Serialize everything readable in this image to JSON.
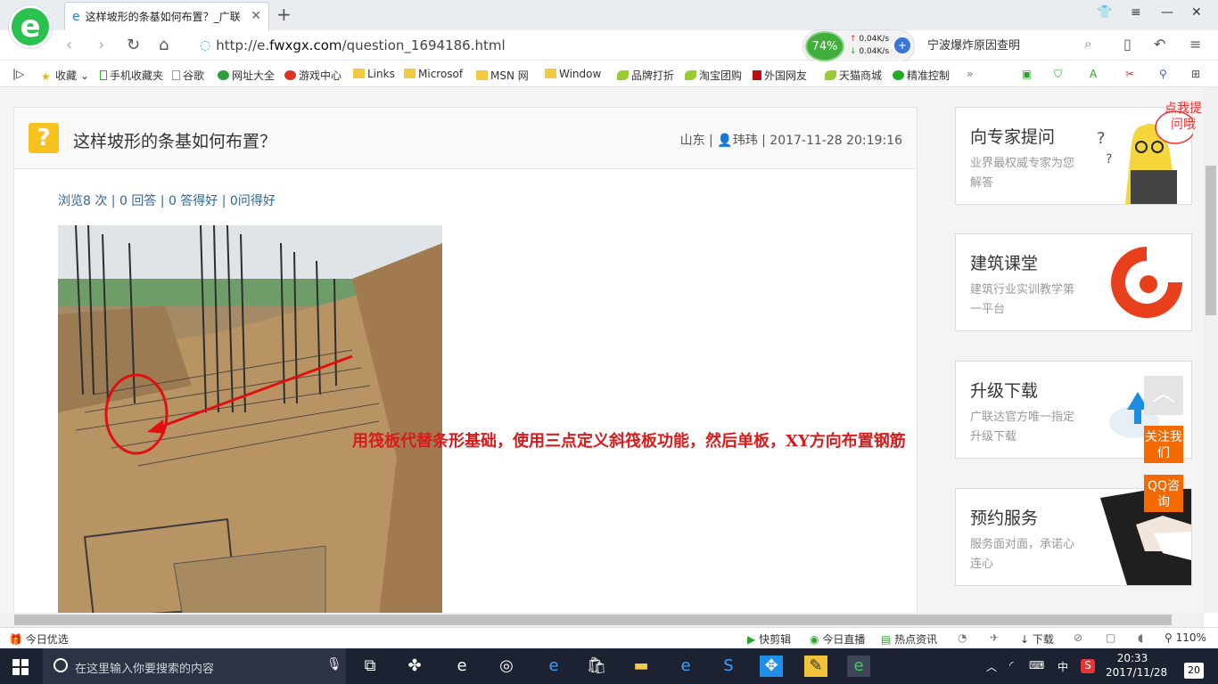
{
  "browser": {
    "tab_title": "这样坡形的条基如何布置？_广联",
    "url_prefix": "http://e.",
    "url_domain": "fwxgx.com",
    "url_path": "/question_1694186.html",
    "cpu_percent": "74%",
    "speed_up": "0.04K/s",
    "speed_down": "0.04K/s",
    "search_text": "宁波爆炸原因查明",
    "zoom": "110%"
  },
  "bookmarks": [
    {
      "label": "收藏",
      "icon": "star-icon"
    },
    {
      "label": "手机收藏夹",
      "icon": "phone-icon"
    },
    {
      "label": "谷歌",
      "icon": "page-icon"
    },
    {
      "label": "网址大全",
      "icon": "globe-icon"
    },
    {
      "label": "游戏中心",
      "icon": "game-icon"
    },
    {
      "label": "Links",
      "icon": "folder-icon"
    },
    {
      "label": "Microsof",
      "icon": "folder-icon"
    },
    {
      "label": "MSN 网",
      "icon": "folder-icon"
    },
    {
      "label": "Window",
      "icon": "folder-icon"
    },
    {
      "label": "品牌打折",
      "icon": "leaf-icon"
    },
    {
      "label": "淘宝团购",
      "icon": "leaf-icon"
    },
    {
      "label": "外国网友",
      "icon": "flag-icon"
    },
    {
      "label": "天猫商城",
      "icon": "leaf-icon"
    },
    {
      "label": "精准控制",
      "icon": "chat-icon"
    }
  ],
  "question": {
    "title": "这样坡形的条基如何布置？",
    "location": "山东",
    "author": "玮玮",
    "datetime": "2017-11-28 20:19:16",
    "stats": "浏览8 次 | 0 回答 | 0 答得好 | 0问得好",
    "annotation": "用筏板代替条形基础，使用三点定义斜筏板功能，然后单板，XY方向布置钢筋"
  },
  "sidebar": [
    {
      "title": "向专家提问",
      "desc": "业界最权威专家为您解答",
      "badge": "点我提问哦"
    },
    {
      "title": "建筑课堂",
      "desc": "建筑行业实训教学第一平台"
    },
    {
      "title": "升级下载",
      "desc": "广联达官方唯一指定升级下载"
    },
    {
      "title": "预约服务",
      "desc": "服务面对面，承诺心连心"
    }
  ],
  "float_buttons": {
    "follow": "关注我们",
    "qq": "QQ咨询"
  },
  "statusbar": {
    "left": "今日优选",
    "items": [
      "快剪辑",
      "今日直播",
      "热点资讯",
      "下载"
    ]
  },
  "taskbar": {
    "search_placeholder": "在这里输入你要搜索的内容",
    "ime": "中",
    "time": "20:33",
    "date": "2017/11/28",
    "notifications": "20"
  },
  "colors": {
    "accent_orange": "#f56a00",
    "question_yellow": "#f7c21d",
    "annotation_red": "#d81b1b",
    "link_blue": "#336699"
  }
}
